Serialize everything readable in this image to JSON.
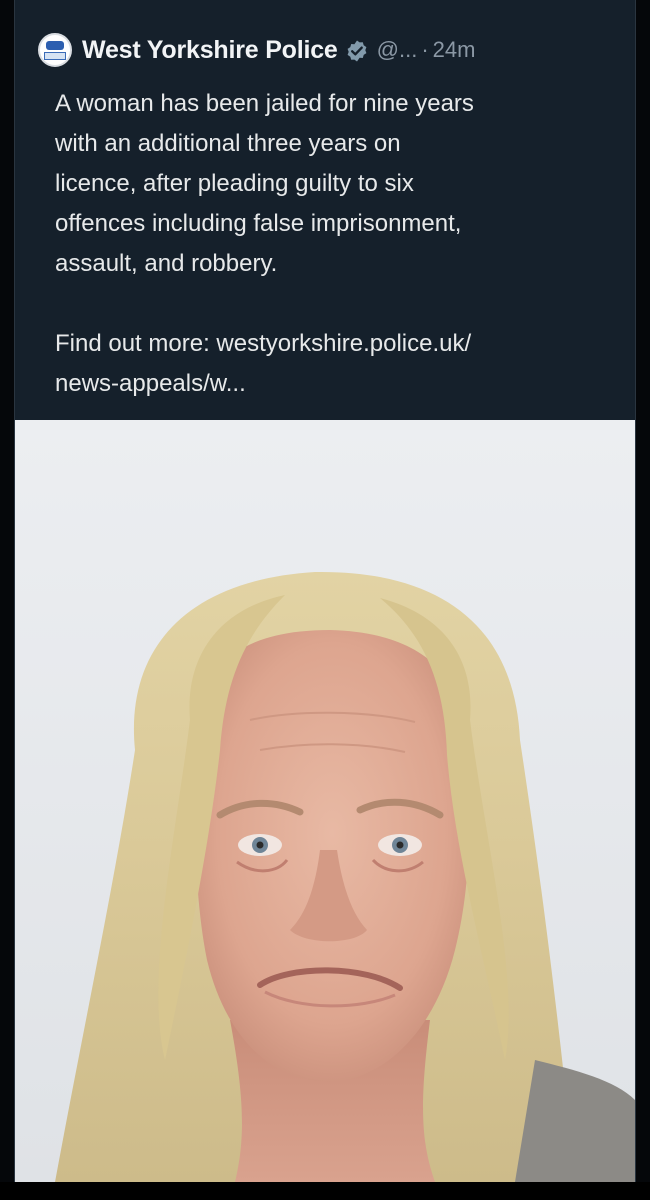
{
  "post": {
    "author_name": "West Yorkshire Police",
    "handle": "@...",
    "separator": "·",
    "time_ago": "24m",
    "body_lines": [
      "A woman has been jailed for nine years",
      "with an additional three years on",
      "licence, after pleading guilty to six",
      "offences including false imprisonment,",
      "assault, and robbery."
    ],
    "link_lines": [
      "Find out more: westyorkshire.police.uk/",
      "news-appeals/w..."
    ]
  },
  "icons": {
    "avatar": "police-logo-avatar",
    "verified": "verified-badge-icon"
  },
  "colors": {
    "card_background": "#15202b",
    "text_primary": "#e7e9ea",
    "text_secondary": "#8b98a5",
    "verified_badge": "#829aab"
  }
}
